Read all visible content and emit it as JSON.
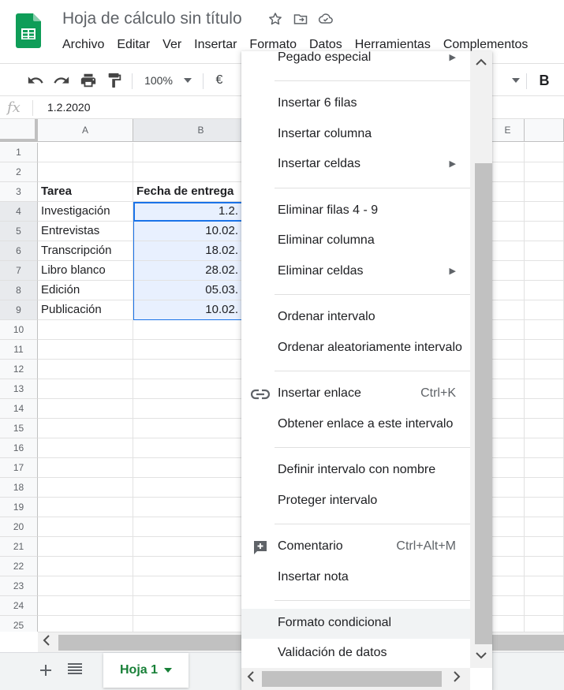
{
  "app": {
    "doc_title": "Hoja de cálculo sin título",
    "brand_color": "#0f9d58"
  },
  "menubar": {
    "items": [
      "Archivo",
      "Editar",
      "Ver",
      "Insertar",
      "Formato",
      "Datos",
      "Herramientas",
      "Complementos"
    ]
  },
  "toolbar": {
    "zoom": "100%",
    "currency": "€",
    "bold": "B"
  },
  "formula_bar": {
    "fx": "fx",
    "value": "1.2.2020"
  },
  "grid": {
    "columns": [
      "A",
      "B",
      "E"
    ],
    "rows": [
      "1",
      "2",
      "3",
      "4",
      "5",
      "6",
      "7",
      "8",
      "9",
      "10",
      "11",
      "12",
      "13",
      "14",
      "15",
      "16",
      "17",
      "18",
      "19",
      "20",
      "21",
      "22",
      "23",
      "24",
      "25"
    ],
    "header_row": [
      "Tarea",
      "Fecha de entrega"
    ],
    "data": [
      {
        "task": "Investigación",
        "date": "1.2."
      },
      {
        "task": "Entrevistas",
        "date": "10.02."
      },
      {
        "task": "Transcripción",
        "date": "18.02."
      },
      {
        "task": "Libro blanco",
        "date": "28.02."
      },
      {
        "task": "Edición",
        "date": "05.03."
      },
      {
        "task": "Publicación",
        "date": "10.02."
      }
    ]
  },
  "sheets": {
    "active_tab": "Hoja 1",
    "tab_color": "#188038"
  },
  "context_menu": {
    "items": [
      {
        "label": "Pegado especial",
        "submenu": true
      },
      {
        "label": "Insertar 6 filas"
      },
      {
        "label": "Insertar columna"
      },
      {
        "label": "Insertar celdas",
        "submenu": true
      },
      {
        "label": "Eliminar filas 4 - 9"
      },
      {
        "label": "Eliminar columna"
      },
      {
        "label": "Eliminar celdas",
        "submenu": true
      },
      {
        "label": "Ordenar intervalo"
      },
      {
        "label": "Ordenar aleatoriamente intervalo"
      },
      {
        "label": "Insertar enlace",
        "shortcut": "Ctrl+K",
        "icon": "link-icon"
      },
      {
        "label": "Obtener enlace a este intervalo"
      },
      {
        "label": "Definir intervalo con nombre"
      },
      {
        "label": "Proteger intervalo"
      },
      {
        "label": "Comentario",
        "shortcut": "Ctrl+Alt+M",
        "icon": "add-comment-icon"
      },
      {
        "label": "Insertar nota"
      },
      {
        "label": "Formato condicional",
        "hovered": true
      },
      {
        "label": "Validación de datos"
      }
    ]
  }
}
